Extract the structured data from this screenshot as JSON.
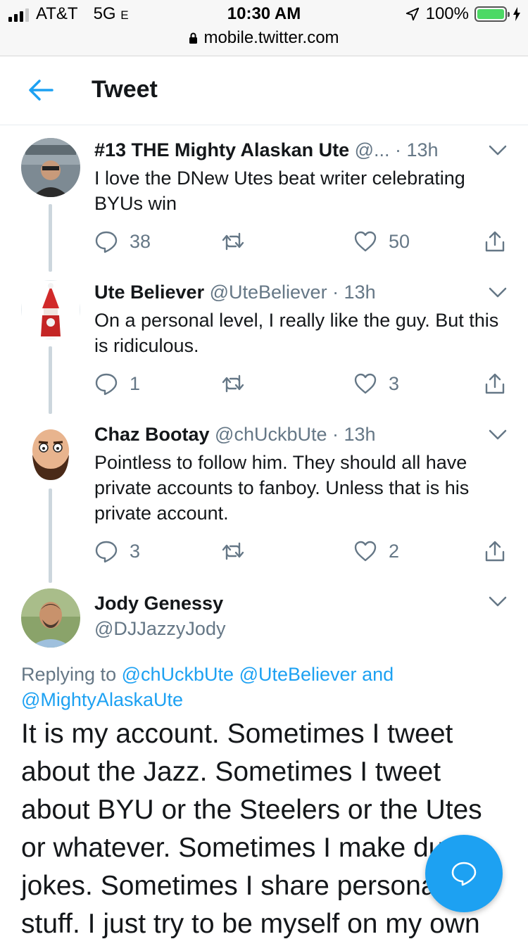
{
  "statusbar": {
    "carrier": "AT&T",
    "network": "5G",
    "network_suffix": "E",
    "time": "10:30 AM",
    "battery": "100%",
    "url": "mobile.twitter.com"
  },
  "header": {
    "title": "Tweet"
  },
  "tweets": [
    {
      "name": "#13 THE Mighty Alaskan Ute",
      "meta": " @... · 13h",
      "text": "I love the DNew Utes beat writer celebrating BYUs win",
      "replies": "38",
      "retweets": "",
      "likes": "50"
    },
    {
      "name": "Ute Believer",
      "meta": " @UteBeliever · 13h",
      "text": "On a personal level, I really like the guy.  But this is ridiculous.",
      "replies": "1",
      "retweets": "",
      "likes": "3"
    },
    {
      "name": "Chaz Bootay",
      "meta": " @chUckbUte · 13h",
      "text": "Pointless to follow him. They should all have private accounts to fanboy. Unless that is his private account.",
      "replies": "3",
      "retweets": "",
      "likes": "2"
    }
  ],
  "main_tweet": {
    "name": "Jody Genessy",
    "handle": "@DJJazzyJody",
    "replying_prefix": "Replying to ",
    "mention1": "@chUckbUte",
    "mention2": "@UteBeliever",
    "and": "and",
    "mention3": "@MightyAlaskaUte",
    "text": "It is my account. Sometimes I tweet about the Jazz. Sometimes I tweet about BYU or the Steelers or the Utes or whatever. Sometimes I make dumb jokes. Sometimes I share personal stuff. I just try to be myself on my own"
  },
  "colors": {
    "accent": "#1da1f2",
    "text": "#14171a",
    "meta": "#657786",
    "line": "#ccd6dd"
  },
  "icons": [
    "back-arrow-icon",
    "reply-icon",
    "retweet-icon",
    "like-icon",
    "share-icon",
    "chevron-down-icon",
    "compose-reply-icon"
  ]
}
